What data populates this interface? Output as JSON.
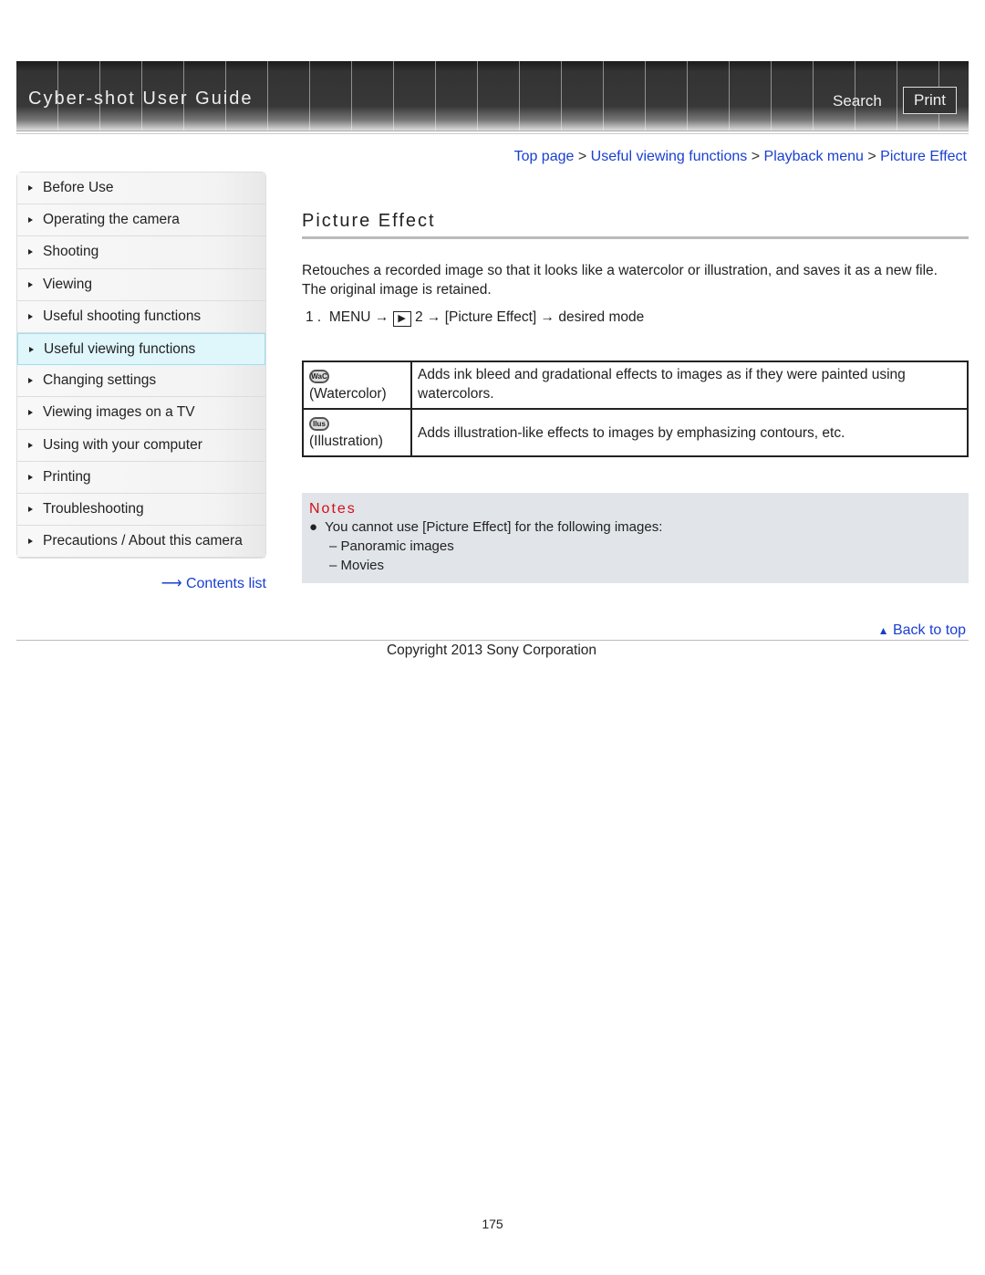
{
  "header": {
    "title": "Cyber-shot User Guide",
    "search": "Search",
    "print": "Print"
  },
  "breadcrumb": [
    "Top page",
    "Useful viewing functions",
    "Playback menu",
    "Picture Effect"
  ],
  "sidebar": {
    "items": [
      "Before Use",
      "Operating the camera",
      "Shooting",
      "Viewing",
      "Useful shooting functions",
      "Useful viewing functions",
      "Changing settings",
      "Viewing images on a TV",
      "Using with your computer",
      "Printing",
      "Troubleshooting",
      "Precautions / About this camera"
    ],
    "selected": "Useful viewing functions",
    "contents": "Contents list"
  },
  "main": {
    "title": "Picture Effect",
    "intro1": "Retouches a recorded image so that it looks like a watercolor or illustration, and saves it as a new file.",
    "intro2": "The original image is retained.",
    "step": {
      "num": "1 .",
      "menu": "MENU",
      "tab": "2",
      "item": "[Picture Effect]",
      "end": "desired mode"
    },
    "modes": [
      {
        "icon": "WaC",
        "name": "(Watercolor)",
        "desc": "Adds ink bleed and gradational effects to images as if they were painted using watercolors."
      },
      {
        "icon": "Ilus",
        "name": "(Illustration)",
        "desc": "Adds illustration-like effects to images by emphasizing contours, etc."
      }
    ],
    "notes": {
      "title": "Notes",
      "text": "You cannot use [Picture Effect] for the following images:",
      "sub": [
        "Panoramic images",
        "Movies"
      ]
    }
  },
  "footer": {
    "back": "Back to top",
    "copyright": "Copyright 2013 Sony Corporation",
    "page": "175"
  }
}
